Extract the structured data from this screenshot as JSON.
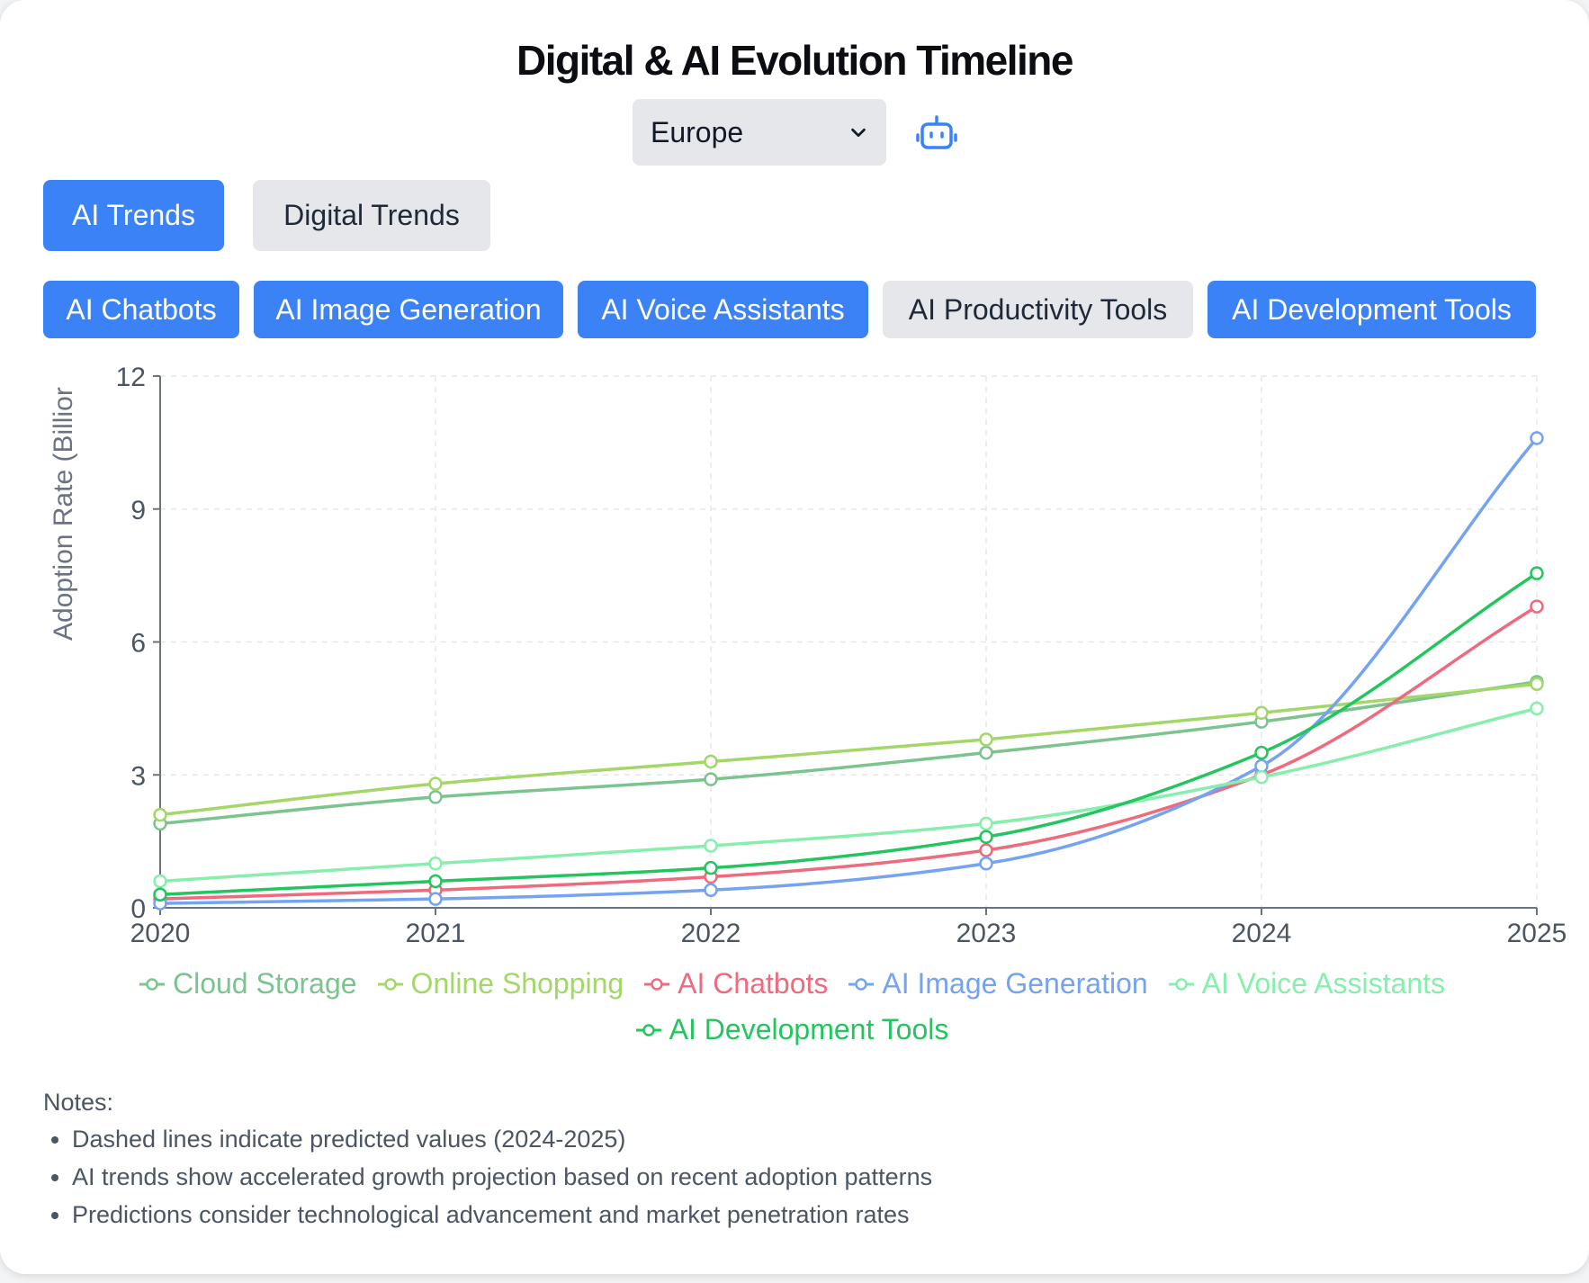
{
  "title": "Digital & AI Evolution Timeline",
  "region": {
    "selected": "Europe"
  },
  "tabs": [
    {
      "label": "AI Trends",
      "active": true
    },
    {
      "label": "Digital Trends",
      "active": false
    }
  ],
  "filters": [
    {
      "label": "AI Chatbots",
      "active": true
    },
    {
      "label": "AI Image Generation",
      "active": true
    },
    {
      "label": "AI Voice Assistants",
      "active": true
    },
    {
      "label": "AI Productivity Tools",
      "active": false
    },
    {
      "label": "AI Development Tools",
      "active": true
    }
  ],
  "colors": {
    "accent": "#3b82f6",
    "inactive": "#e5e7eb"
  },
  "chart_data": {
    "type": "line",
    "ylabel": "Adoption Rate (Billior",
    "xlabel": "",
    "x": [
      2020,
      2021,
      2022,
      2023,
      2024,
      2025
    ],
    "xlim": [
      2020,
      2025
    ],
    "ylim": [
      0,
      12
    ],
    "yticks": [
      0,
      3,
      6,
      9,
      12
    ],
    "grid": true,
    "legend": "bottom",
    "series": [
      {
        "name": "Cloud Storage",
        "color": "#7bc48f",
        "values": [
          1.9,
          2.5,
          2.9,
          3.5,
          4.2,
          5.1
        ]
      },
      {
        "name": "Online Shopping",
        "color": "#a3d768",
        "values": [
          2.1,
          2.8,
          3.3,
          3.8,
          4.4,
          5.05
        ]
      },
      {
        "name": "AI Chatbots",
        "color": "#f06a7e",
        "values": [
          0.2,
          0.4,
          0.7,
          1.3,
          3.0,
          6.8
        ]
      },
      {
        "name": "AI Image Generation",
        "color": "#74a3f3",
        "values": [
          0.1,
          0.2,
          0.4,
          1.0,
          3.2,
          10.6
        ]
      },
      {
        "name": "AI Voice Assistants",
        "color": "#86efac",
        "values": [
          0.6,
          1.0,
          1.4,
          1.9,
          2.95,
          4.5
        ]
      },
      {
        "name": "AI Development Tools",
        "color": "#22c55e",
        "values": [
          0.3,
          0.6,
          0.9,
          1.6,
          3.5,
          7.55
        ]
      }
    ]
  },
  "notes": {
    "heading": "Notes:",
    "items": [
      "Dashed lines indicate predicted values (2024-2025)",
      "AI trends show accelerated growth projection based on recent adoption patterns",
      "Predictions consider technological advancement and market penetration rates"
    ]
  }
}
